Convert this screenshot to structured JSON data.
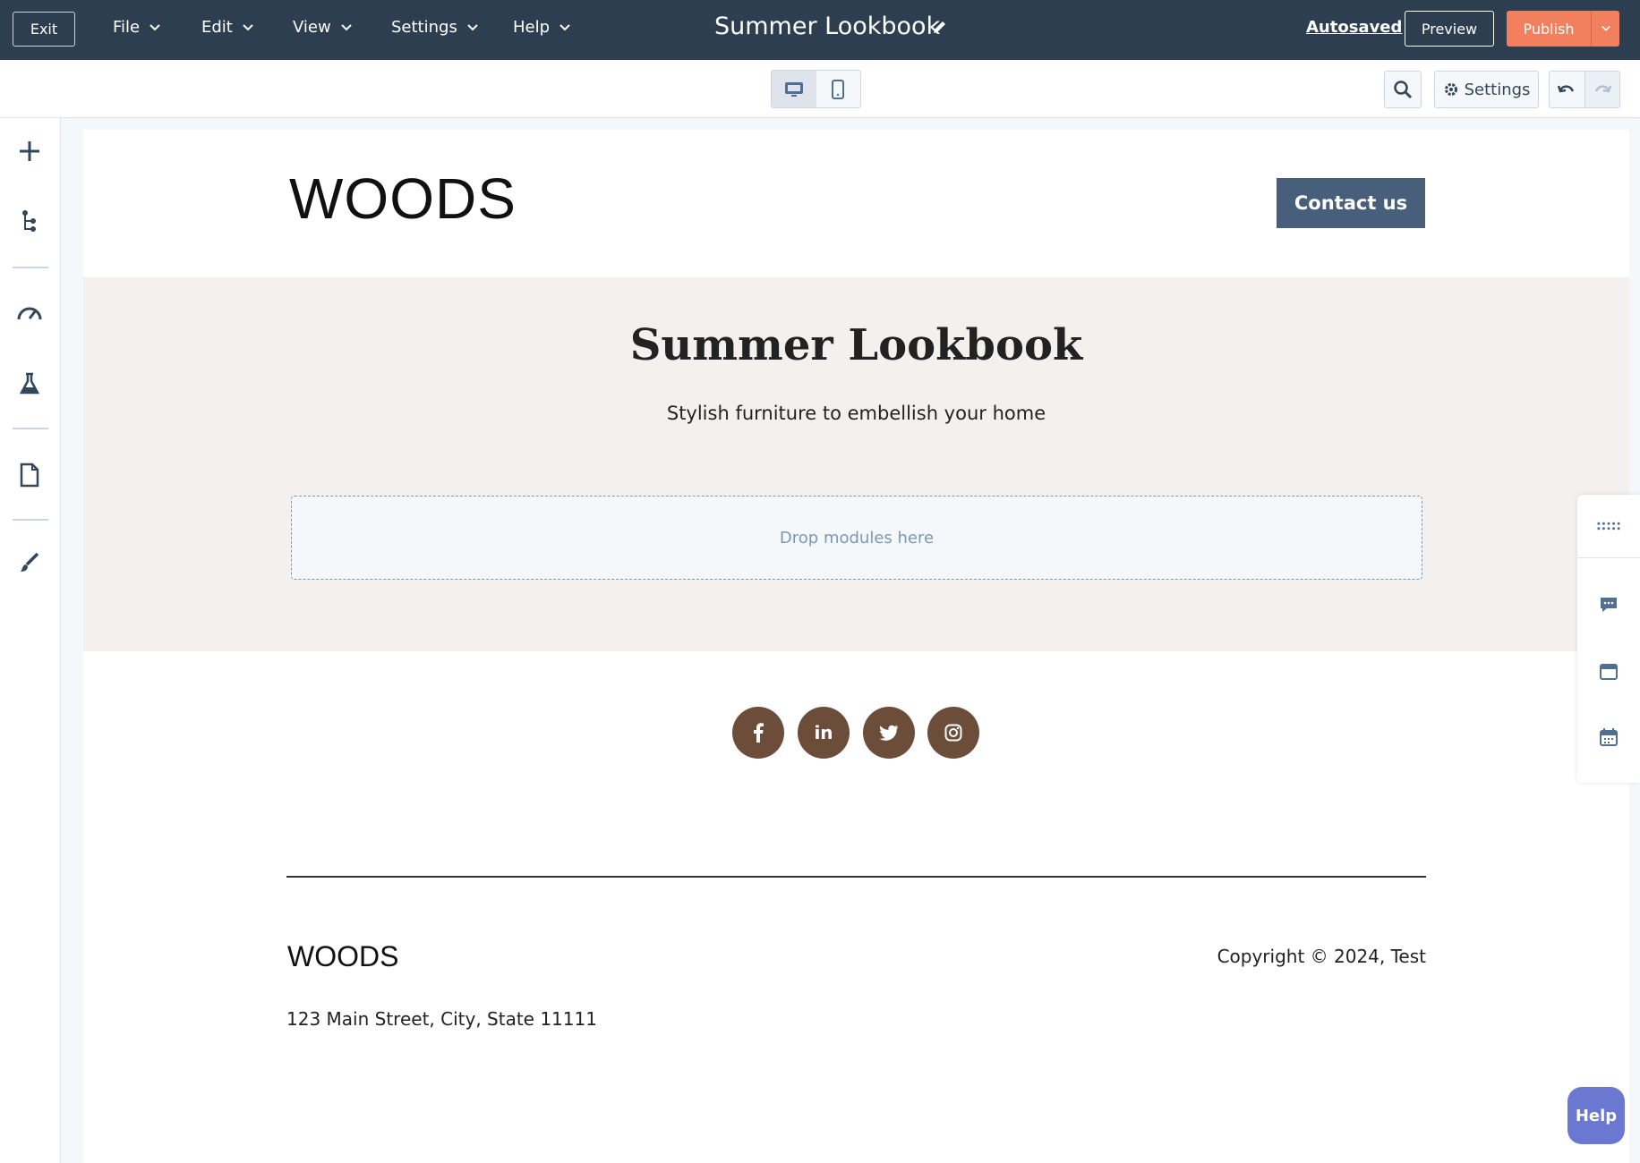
{
  "topbar": {
    "exit_label": "Exit",
    "menus": [
      "File",
      "Edit",
      "View",
      "Settings",
      "Help"
    ],
    "title": "Summer Lookbook",
    "autosaved": "Autosaved",
    "preview_label": "Preview",
    "publish_label": "Publish"
  },
  "toolbar": {
    "settings_label": "Settings"
  },
  "page": {
    "logo": "WOODS",
    "contact_label": "Contact us",
    "hero_title": "Summer Lookbook",
    "hero_subtitle": "Stylish furniture to embellish your home",
    "dropzone_label": "Drop modules here",
    "social": [
      "f",
      "in",
      "twitter",
      "instagram"
    ],
    "footer_logo": "WOODS",
    "copyright": "Copyright © 2024, Test",
    "address": "123 Main Street, City, State 11111"
  },
  "help_label": "Help",
  "colors": {
    "topbar": "#2d3e50",
    "publish": "#f2805f",
    "contact": "#475f7b",
    "hero_bg": "#f3f0ed",
    "social": "#6b4d3a",
    "help": "#6a78d1"
  }
}
